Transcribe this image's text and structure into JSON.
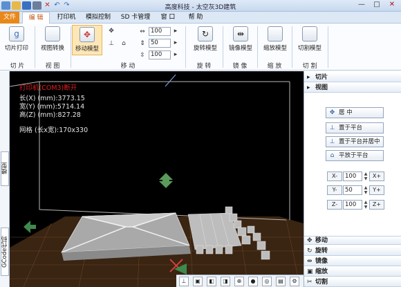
{
  "window": {
    "title": "高度科技 - 太空灰3D建筑",
    "controls": [
      "—",
      "□",
      "✕"
    ]
  },
  "menu": {
    "tabs": [
      {
        "label": "文件"
      },
      {
        "label": "编 辑"
      },
      {
        "label": "打印机"
      },
      {
        "label": "模拟控制"
      },
      {
        "label": "SD 卡管理"
      },
      {
        "label": "窗 口"
      },
      {
        "label": "帮 助"
      }
    ]
  },
  "ribbon": {
    "slice_print": "切片打印",
    "view_convert": "视图转换",
    "move_model": "移动模型",
    "rotate_model": "旋转模型",
    "mirror_model": "镜像模型",
    "scale_model": "缩放模型",
    "cut_model": "切割模型",
    "spin_values": [
      "100",
      "50",
      "100"
    ],
    "groups": {
      "slice": "切 片",
      "view": "视 图",
      "move": "移 动",
      "rotate": "旋 转",
      "mirror": "镜 像",
      "scale": "缩 放",
      "cut": "切 割"
    }
  },
  "viewport": {
    "status": "打印机(COM3)断开",
    "length": "长(X) (mm):3773.15",
    "width": "宽(Y) (mm):5714.14",
    "height": "高(Z) (mm):827.28",
    "grid": "网格 (长x宽):170x330"
  },
  "left_tabs": {
    "model": "模型",
    "gcode": "GCode代码"
  },
  "right_panel": {
    "sections": {
      "slice": "切片",
      "view": "视图",
      "move": "移动",
      "rotate": "旋转",
      "mirror": "镜像",
      "scale": "缩放",
      "cut": "切割"
    },
    "center_btn": "居 中",
    "place_platform": "置于平台",
    "place_center": "置于平台并居中",
    "lay_flat": "平放于平台",
    "axes": [
      {
        "minus": "X-",
        "value": "100",
        "plus": "X+"
      },
      {
        "minus": "Y-",
        "value": "50",
        "plus": "Y+"
      },
      {
        "minus": "Z-",
        "value": "100",
        "plus": "Z+"
      }
    ]
  }
}
